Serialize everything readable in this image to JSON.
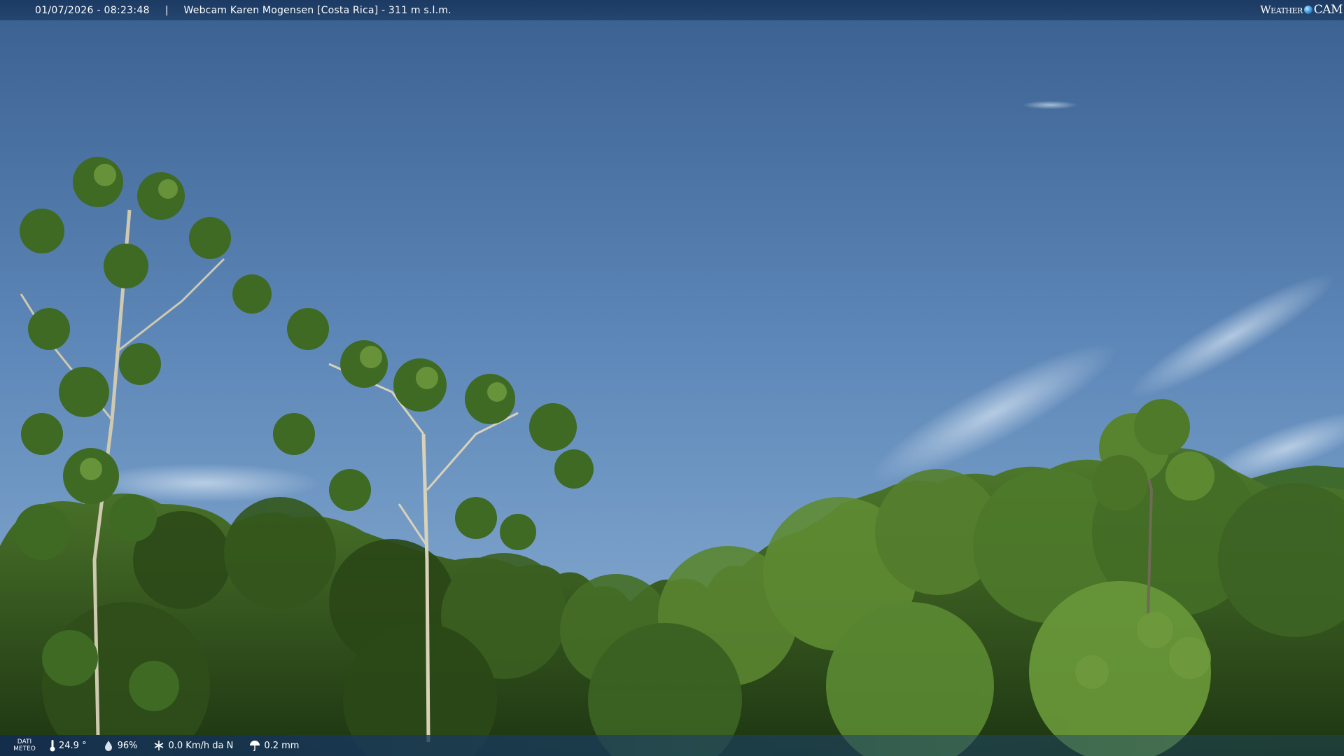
{
  "topbar": {
    "datetime": "01/07/2026 - 08:23:48",
    "separator": "|",
    "title": "Webcam Karen Mogensen [Costa Rica] - 311 m s.l.m."
  },
  "logo": {
    "word1": "Weather",
    "word2": "CAM"
  },
  "weather": {
    "label_line1": "DATI",
    "label_line2": "METEO",
    "temperature": "24.9 °",
    "humidity": "96%",
    "wind": "0.0 Km/h da N",
    "rain": "0.2 mm"
  },
  "icons": {
    "temperature": "thermometer-icon",
    "humidity": "humidity-drop-icon",
    "wind": "wind-icon",
    "rain": "rain-umbrella-icon"
  },
  "colors": {
    "sky_top": "#3d6494",
    "sky_bottom": "#7da4cc",
    "foliage_dark": "#1f3a12",
    "foliage_mid": "#3f6a22",
    "foliage_light": "#6f9a3a"
  }
}
